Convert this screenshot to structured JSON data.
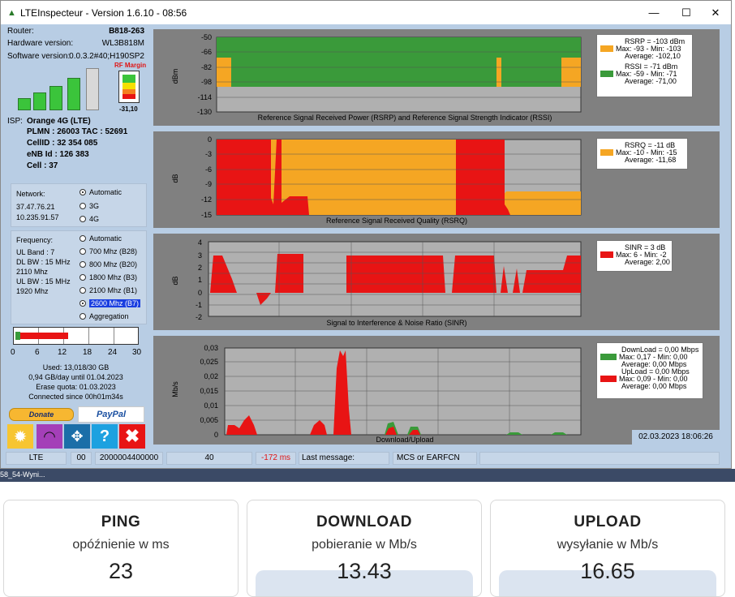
{
  "window": {
    "title": "LTEInspecteur - Version 1.6.10 - 08:56",
    "min": "—",
    "max": "☐",
    "close": "✕"
  },
  "router": {
    "label": "Router:",
    "value": "B818-263"
  },
  "hardware": {
    "label": "Hardware version:",
    "value": "WL3B818M"
  },
  "software": {
    "label": "Software version:",
    "value": "0.0.3.2#40;H190SP2"
  },
  "signal": {
    "bars_active": 4,
    "bars_total": 5,
    "rf_margin_label": "RF Margin",
    "rf_margin_value": "-31,10"
  },
  "isp": {
    "label": "ISP:",
    "name": "Orange 4G (LTE)",
    "plmn": "PLMN : 26003 TAC : 52691",
    "cellid": "CellID : 32 354 085",
    "enb": "eNB Id : 126 383",
    "cell": "Cell : 37"
  },
  "network": {
    "label": "Network:",
    "ip1": "37.47.76.21",
    "ip2": "10.235.91.57",
    "options": [
      "Automatic",
      "3G",
      "4G"
    ],
    "selected": 0
  },
  "frequency": {
    "label": "Frequency:",
    "info": [
      "UL Band : 7",
      "DL BW : 15 MHz",
      "2110 Mhz",
      "UL BW : 15 MHz",
      "1920 Mhz"
    ],
    "options": [
      "Automatic",
      "700 Mhz (B28)",
      "800 Mhz (B20)",
      "1800 Mhz (B3)",
      "2100 Mhz (B1)",
      "2600 Mhz (B7)",
      "Aggregation"
    ],
    "selected": 5
  },
  "quota": {
    "used_fraction": 0.434,
    "ticks": [
      "0",
      "6",
      "12",
      "18",
      "24",
      "30"
    ],
    "used": "Used: 13,018/30 GB",
    "perday": "0,94 GB/day until 01.04.2023",
    "erase": "Erase quota: 01.03.2023",
    "connected": "Connected since 00h01m34s"
  },
  "donate": {
    "donate": "Donate",
    "paypal": "PayPal"
  },
  "colors": {
    "green": "#3a9a3a",
    "orange": "#f5a623",
    "red": "#e81414",
    "gray": "#a0a0a0"
  },
  "charts": {
    "rsrp": {
      "ylabel": "dBm",
      "ticks": [
        "-50",
        "-66",
        "-82",
        "-98",
        "-114",
        "-130"
      ],
      "caption": "Reference Signal Received Power (RSRP) and Reference Signal Strength Indicator (RSSI)",
      "leg1": [
        "RSRP = -103 dBm",
        "Max: -93 - Min: -103",
        "Average: -102,10"
      ],
      "leg2": [
        "RSSI = -71 dBm",
        "Max: -59 - Min: -71",
        "Average: -71,00"
      ]
    },
    "rsrq": {
      "ylabel": "dB",
      "ticks": [
        "0",
        "-3",
        "-6",
        "-9",
        "-12",
        "-15"
      ],
      "caption": "Reference Signal Received Quality (RSRQ)",
      "leg1": [
        "RSRQ = -11 dB",
        "Max: -10 - Min: -15",
        "Average: -11,68"
      ]
    },
    "sinr": {
      "ylabel": "dB",
      "ticks": [
        "4",
        "3",
        "2",
        "1",
        "0",
        "-1",
        "-2"
      ],
      "caption": "Signal to Interference & Noise Ratio (SINR)",
      "leg1": [
        "SINR = 3 dB",
        "Max: 6 - Min: -2",
        "Average: 2,00"
      ]
    },
    "load": {
      "ylabel": "Mb/s",
      "ticks": [
        "0,03",
        "0,025",
        "0,02",
        "0,015",
        "0,01",
        "0,005",
        "0"
      ],
      "caption": "Download/Upload",
      "leg1": [
        "DownLoad = 0,00 Mbps",
        "Max: 0,17 - Min: 0,00",
        "Average: 0,00 Mbps"
      ],
      "leg2": [
        "UpLoad = 0,00 Mbps",
        "Max: 0,09 - Min: 0,00",
        "Average: 0,00 Mbps"
      ],
      "datetime": "02.03.2023 18:06:26"
    }
  },
  "status": {
    "mode": "LTE",
    "code": "00",
    "id": "2000004400000",
    "num": "40",
    "ping": "-172 ms",
    "msg_label": "Last message:",
    "msg2": "MCS or EARFCN",
    "msg3": ""
  },
  "taskbar": {
    "text": "58_54-Wyni..."
  },
  "cards": [
    {
      "title": "PING",
      "sub": "opóźnienie w ms",
      "value": "23"
    },
    {
      "title": "DOWNLOAD",
      "sub": "pobieranie w Mb/s",
      "value": "13.43"
    },
    {
      "title": "UPLOAD",
      "sub": "wysyłanie w Mb/s",
      "value": "16.65"
    }
  ]
}
